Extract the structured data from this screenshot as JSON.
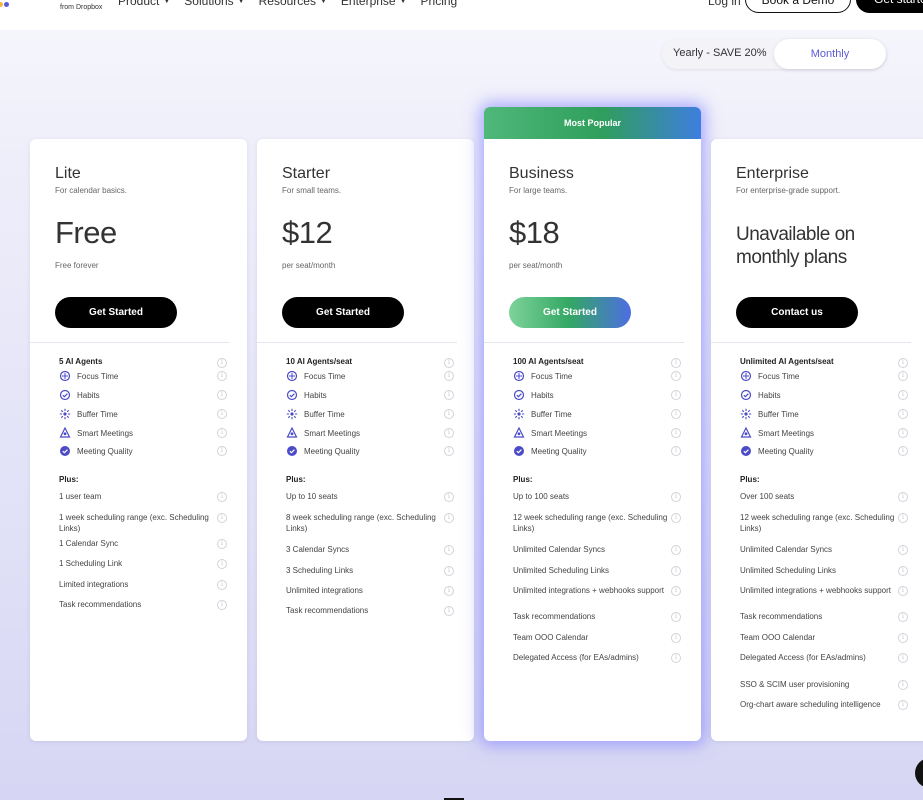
{
  "header": {
    "logo_sub": "from Dropbox",
    "nav": [
      {
        "label": "Product"
      },
      {
        "label": "Solutions"
      },
      {
        "label": "Resources"
      },
      {
        "label": "Enterprise"
      },
      {
        "label": "Pricing"
      }
    ],
    "login": "Log in",
    "demo": "Book a Demo",
    "start": "Get started"
  },
  "billing": {
    "yearly": "Yearly - SAVE 20%",
    "monthly": "Monthly"
  },
  "popular_label": "Most Popular",
  "feature_icons": [
    "focus-time-icon",
    "habits-icon",
    "buffer-time-icon",
    "smart-meetings-icon",
    "meeting-quality-icon"
  ],
  "plans": [
    {
      "name": "Lite",
      "desc": "For calendar basics.",
      "price": "Free",
      "price_note": "Free forever",
      "cta": "Get Started",
      "agents": "5 AI Agents",
      "features": [
        "Focus Time",
        "Habits",
        "Buffer Time",
        "Smart Meetings",
        "Meeting Quality"
      ],
      "plus_label": "Plus:",
      "plus": [
        "1 user team",
        "1 week scheduling range (exc. Scheduling Links)",
        "1 Calendar Sync",
        "1 Scheduling Link",
        "Limited integrations",
        "Task recommendations"
      ]
    },
    {
      "name": "Starter",
      "desc": "For small teams.",
      "price": "$12",
      "price_note": "per seat/month",
      "cta": "Get Started",
      "agents": "10 AI Agents/seat",
      "features": [
        "Focus Time",
        "Habits",
        "Buffer Time",
        "Smart Meetings",
        "Meeting Quality"
      ],
      "plus_label": "Plus:",
      "plus": [
        "Up to 10 seats",
        "8 week scheduling range (exc. Scheduling Links)",
        "3 Calendar Syncs",
        "3 Scheduling Links",
        "Unlimited integrations",
        "Task recommendations"
      ]
    },
    {
      "name": "Business",
      "desc": "For large teams.",
      "price": "$18",
      "price_note": "per seat/month",
      "cta": "Get Started",
      "agents": "100 AI Agents/seat",
      "features": [
        "Focus Time",
        "Habits",
        "Buffer Time",
        "Smart Meetings",
        "Meeting Quality"
      ],
      "plus_label": "Plus:",
      "plus": [
        "Up to 100 seats",
        "12 week scheduling range (exc. Scheduling Links)",
        "Unlimited Calendar Syncs",
        "Unlimited Scheduling Links",
        "Unlimited integrations + webhooks support",
        "Task recommendations",
        "Team OOO Calendar",
        "Delegated Access (for EAs/admins)"
      ]
    },
    {
      "name": "Enterprise",
      "desc": "For enterprise-grade support.",
      "price": "Unavailable on monthly plans",
      "price_note": "",
      "cta": "Contact us",
      "agents": "Unlimited AI Agents/seat",
      "features": [
        "Focus Time",
        "Habits",
        "Buffer Time",
        "Smart Meetings",
        "Meeting Quality"
      ],
      "plus_label": "Plus:",
      "plus": [
        "Over 100 seats",
        "12 week scheduling range (exc. Scheduling Links)",
        "Unlimited Calendar Syncs",
        "Unlimited Scheduling Links",
        "Unlimited integrations + webhooks support",
        "Task recommendations",
        "Team OOO Calendar",
        "Delegated Access (for EAs/admins)",
        "SSO & SCIM user provisioning",
        "Org-chart aware scheduling intelligence"
      ]
    }
  ]
}
